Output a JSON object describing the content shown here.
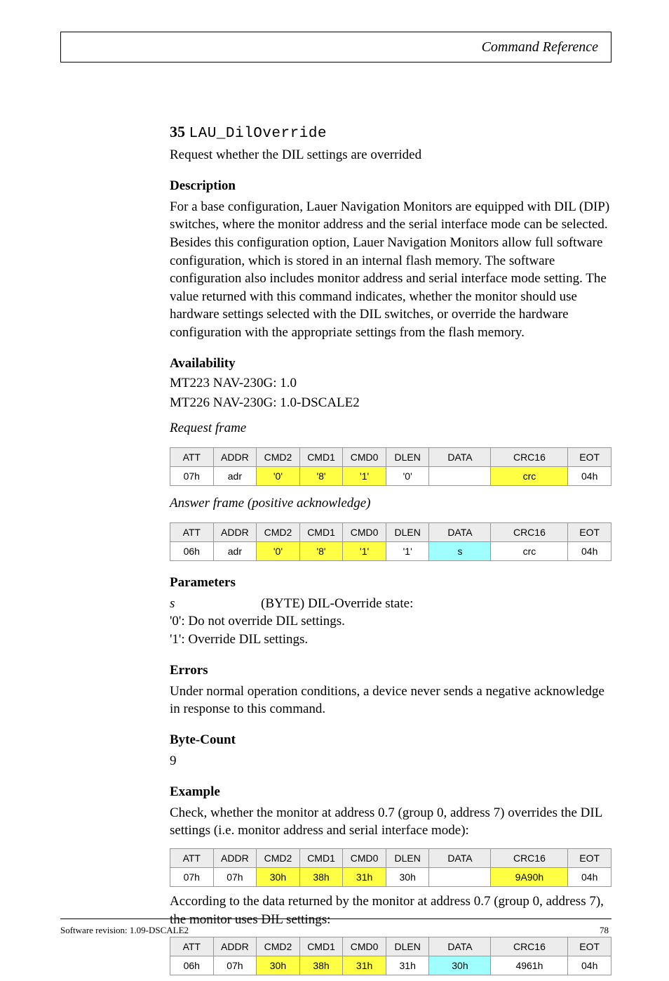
{
  "header": {
    "section_title": "Command Reference"
  },
  "command": {
    "number": "35",
    "name": "LAU_DilOverride",
    "subtitle": "Request whether the DIL settings are overrided",
    "description_heading": "Description",
    "description": "For a base configuration, Lauer Navigation Monitors are equipped with DIL (DIP) switches, where the monitor address and the serial interface mode can be selected. Besides this configuration option, Lauer Navigation Monitors allow full software configuration, which is stored in an internal flash memory. The software configuration also includes monitor address and serial interface mode setting. The value returned with this command indicates, whether the monitor should use hardware settings selected with the DIL switches, or override the hardware configuration with the appropriate settings from the flash memory."
  },
  "availability": {
    "heading": "Availability",
    "lines": [
      "MT223 NAV-230G: 1.0",
      "MT226 NAV-230G: 1.0-DSCALE2"
    ]
  },
  "request_frame": {
    "title": "Request frame",
    "headers": [
      "ATT",
      "ADDR",
      "CMD2",
      "CMD1",
      "CMD0",
      "DLEN",
      "DATA",
      "CRC16",
      "EOT"
    ],
    "row": [
      "07h",
      "adr",
      "'0'",
      "'8'",
      "'1'",
      "'0'",
      "",
      "crc",
      "04h"
    ],
    "yellow_idx": [
      2,
      3,
      4,
      7
    ],
    "cyan_idx": []
  },
  "answer_frame": {
    "title": "Answer frame (positive acknowledge)",
    "headers": [
      "ATT",
      "ADDR",
      "CMD2",
      "CMD1",
      "CMD0",
      "DLEN",
      "DATA",
      "CRC16",
      "EOT"
    ],
    "row": [
      "06h",
      "adr",
      "'0'",
      "'8'",
      "'1'",
      "'1'",
      "s",
      "crc",
      "04h"
    ],
    "yellow_idx": [
      2,
      3,
      4
    ],
    "cyan_idx": [
      6
    ]
  },
  "parameters": {
    "heading": "Parameters",
    "items": [
      {
        "name": "s",
        "type": "(BYTE)",
        "desc": "DIL-Override state:\n'0': Do not override DIL settings.\n'1': Override DIL settings."
      }
    ]
  },
  "errors": {
    "heading": "Errors",
    "text": "Under normal operation conditions, a device never sends a negative acknowledge in response to this command."
  },
  "bytecount": {
    "heading": "Byte-Count",
    "text": "9"
  },
  "example": {
    "heading": "Example",
    "intro": "Check, whether the monitor at address 0.7 (group 0, address 7) overrides the DIL settings (i.e. monitor address and serial interface mode):",
    "req_headers": [
      "ATT",
      "ADDR",
      "CMD2",
      "CMD1",
      "CMD0",
      "DLEN",
      "DATA",
      "CRC16",
      "EOT"
    ],
    "req_row": [
      "07h",
      "07h",
      "30h",
      "38h",
      "31h",
      "30h",
      "",
      "9A90h",
      "04h"
    ],
    "req_yellow_idx": [
      2,
      3,
      4,
      7
    ],
    "req_cyan_idx": [],
    "mid_text": "According to the data returned by the monitor at address 0.7 (group 0, address 7), the monitor uses DIL settings:",
    "ans_headers": [
      "ATT",
      "ADDR",
      "CMD2",
      "CMD1",
      "CMD0",
      "DLEN",
      "DATA",
      "CRC16",
      "EOT"
    ],
    "ans_row": [
      "06h",
      "07h",
      "30h",
      "38h",
      "31h",
      "31h",
      "30h",
      "4961h",
      "04h"
    ],
    "ans_yellow_idx": [
      2,
      3,
      4
    ],
    "ans_cyan_idx": [
      6
    ]
  },
  "footer": {
    "left": "Software revision: 1.09-DSCALE2",
    "page": "78"
  },
  "col_widths": [
    "56",
    "56",
    "56",
    "56",
    "56",
    "56",
    "80",
    "100",
    "56"
  ]
}
